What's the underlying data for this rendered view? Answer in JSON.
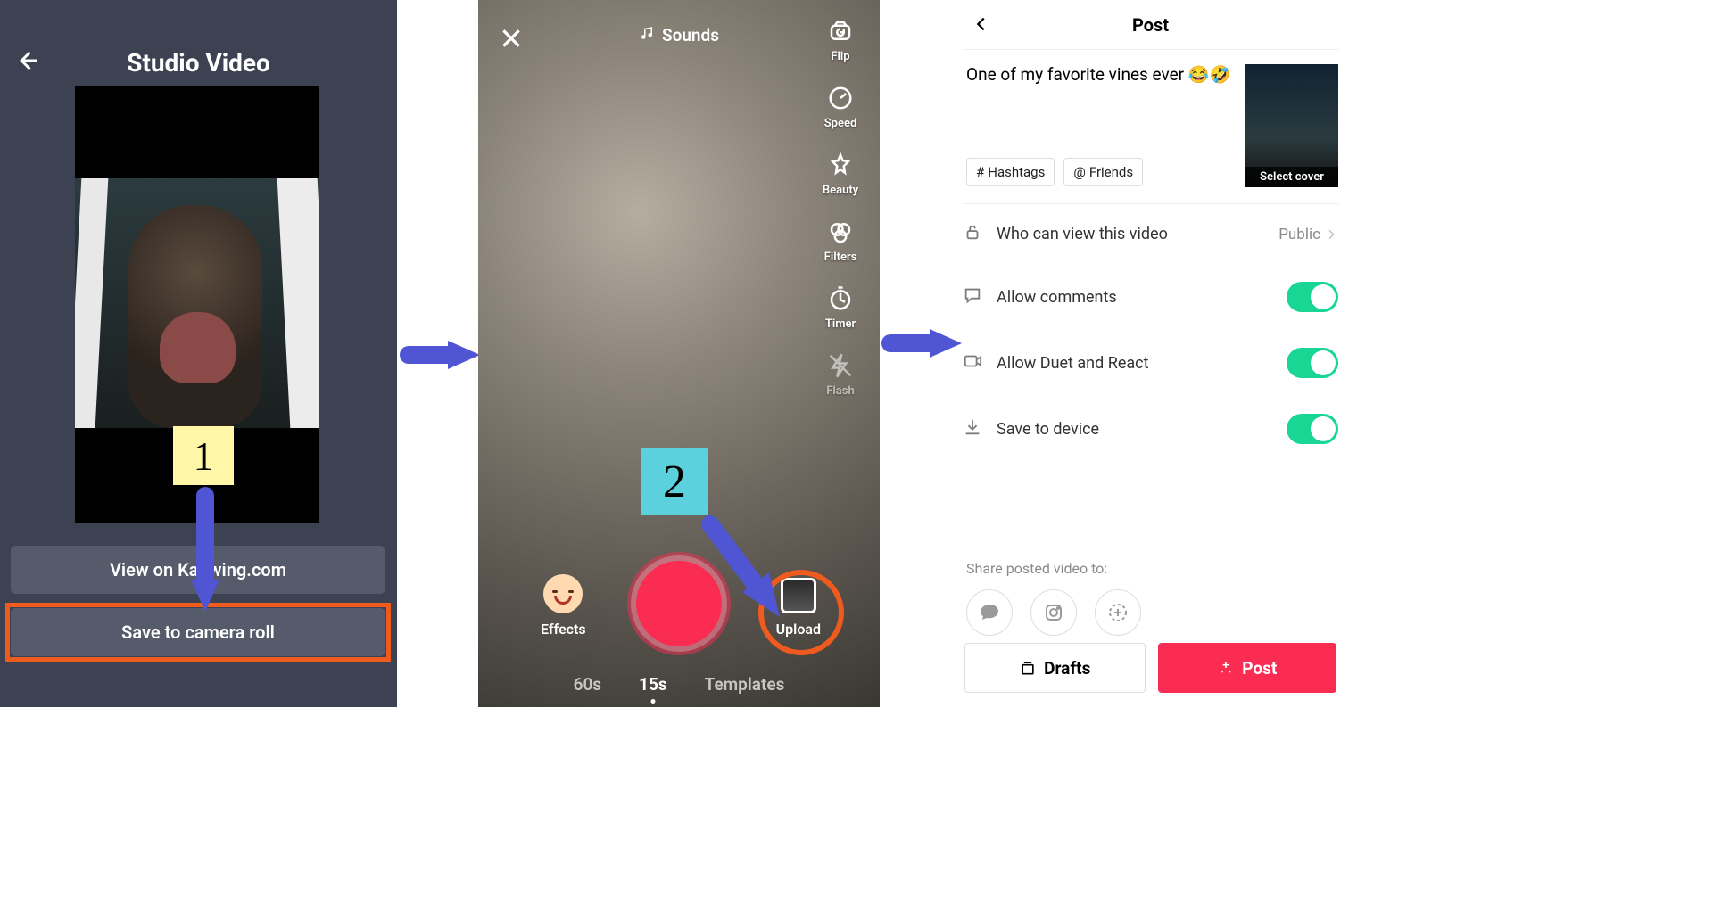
{
  "panel1": {
    "title": "Studio Video",
    "view_button": "View on Kapwing.com",
    "save_button": "Save to camera roll"
  },
  "steps": {
    "one": "1",
    "two": "2"
  },
  "panel2": {
    "sounds": "Sounds",
    "side": {
      "flip": "Flip",
      "speed": "Speed",
      "beauty": "Beauty",
      "filters": "Filters",
      "timer": "Timer",
      "flash": "Flash"
    },
    "effects": "Effects",
    "upload": "Upload",
    "modes": {
      "sixty": "60s",
      "fifteen": "15s",
      "templates": "Templates"
    }
  },
  "panel3": {
    "title": "Post",
    "caption": "One of my favorite vines ever 😂🤣",
    "hashtags_chip": "Hashtags",
    "friends_chip": "Friends",
    "select_cover": "Select cover",
    "privacy_label": "Who can view this video",
    "privacy_value": "Public",
    "allow_comments": "Allow comments",
    "allow_duet": "Allow Duet and React",
    "save_device": "Save to device",
    "share_label": "Share posted video to:",
    "drafts": "Drafts",
    "post": "Post"
  }
}
